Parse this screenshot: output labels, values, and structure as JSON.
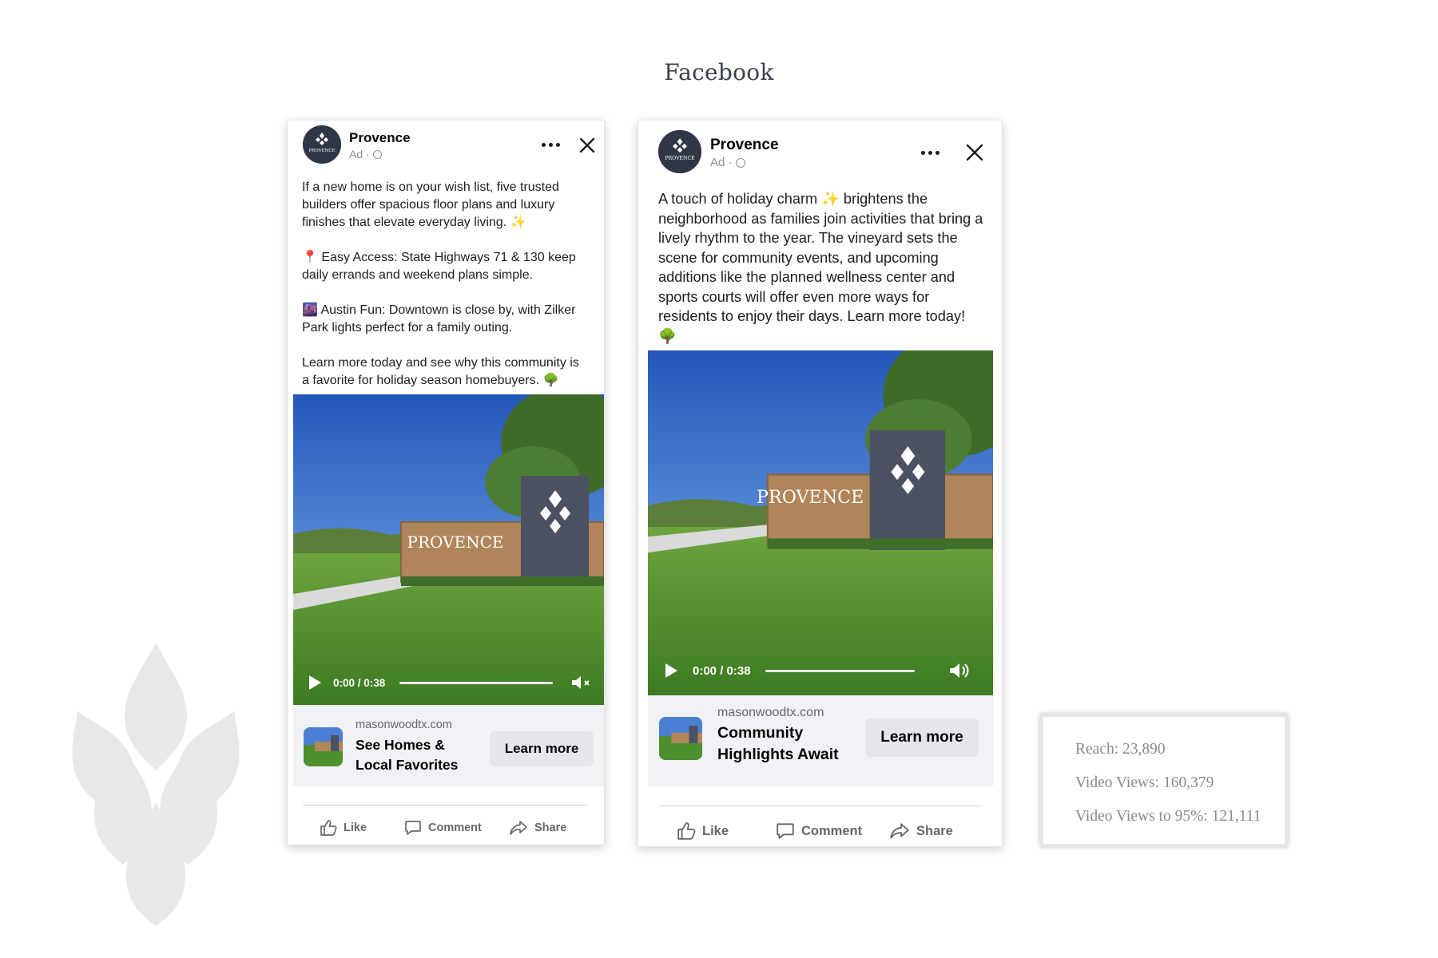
{
  "page": {
    "title": "Facebook"
  },
  "colors": {
    "brand_navy": "#2f3646",
    "sky": "#2f64c9",
    "grass": "#4e8f2e",
    "stone": "#b0855a"
  },
  "ads": [
    {
      "brand": "Provence",
      "sponsored_label": "Ad ·",
      "avatar_text": "PROVENCE",
      "body": "If a new home is on your wish list, five trusted builders offer spacious floor plans and luxury finishes that elevate everyday living. ✨\n\n📍 Easy Access: State Highways 71 & 130 keep daily errands and weekend plans simple.\n\n🌆 Austin Fun: Downtown is close by, with Zilker Park lights perfect for a family outing.\n\nLearn more today and see why this community is a favorite for holiday season homebuyers. 🌳",
      "video": {
        "sign_text": "PROVENCE",
        "time": "0:00 / 0:38",
        "progress": 0.0,
        "muted": true
      },
      "cta": {
        "domain": "masonwoodtx.com",
        "headline": "See Homes &\nLocal Favorites",
        "button": "Learn more"
      },
      "actions": {
        "like": "Like",
        "comment": "Comment",
        "share": "Share"
      }
    },
    {
      "brand": "Provence",
      "sponsored_label": "Ad ·",
      "avatar_text": "PROVENCE",
      "body": "A touch of holiday charm ✨ brightens the neighborhood as families join activities that bring a lively rhythm to the year. The vineyard sets the scene for community events, and upcoming additions like the planned wellness center and sports courts will offer even more ways for residents to enjoy their days. Learn more today! 🌳",
      "video": {
        "sign_text": "PROVENCE",
        "time": "0:00 / 0:38",
        "progress": 0.0,
        "muted": false
      },
      "cta": {
        "domain": "masonwoodtx.com",
        "headline": "Community\nHighlights Await",
        "button": "Learn more"
      },
      "actions": {
        "like": "Like",
        "comment": "Comment",
        "share": "Share"
      }
    }
  ],
  "stats": {
    "reach": "Reach: 23,890",
    "video_views": "Video Views: 160,379",
    "video_views_95": "Video Views to 95%: 121,111"
  }
}
